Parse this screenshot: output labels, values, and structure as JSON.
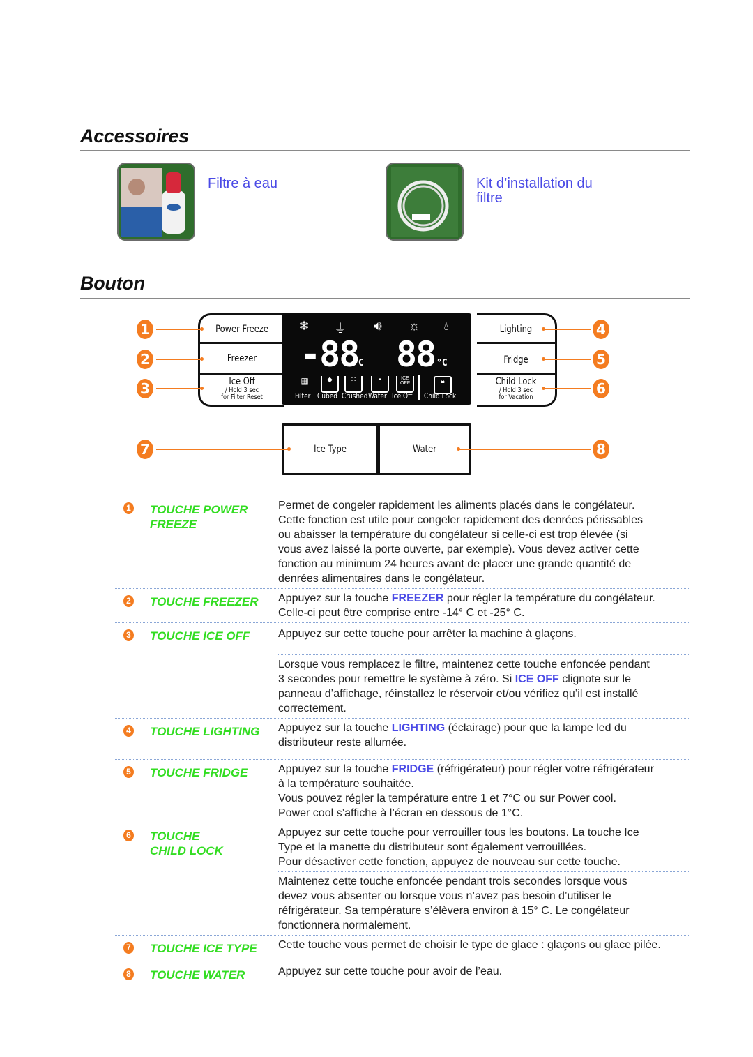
{
  "accessories": {
    "title": "Accessoires",
    "items": [
      {
        "label": "Filtre à eau",
        "image": "water-filter-photo"
      },
      {
        "label_line1": "Kit d’installation du",
        "label_line2": "filtre",
        "image": "filter-install-kit-photo"
      }
    ]
  },
  "buttons_section": {
    "title": "Bouton",
    "panel": {
      "left_buttons": [
        {
          "label": "Power Freeze",
          "callout": "1"
        },
        {
          "label": "Freezer",
          "callout": "2"
        },
        {
          "label": "Ice Off",
          "sub1": "/ Hold 3 sec",
          "sub2": "for Filter Reset",
          "callout": "3"
        }
      ],
      "right_buttons": [
        {
          "label": "Lighting",
          "callout": "4"
        },
        {
          "label": "Fridge",
          "callout": "5"
        },
        {
          "label": "Child Lock",
          "sub1": "/ Hold 3 sec",
          "sub2": "for Vacation",
          "callout": "6"
        }
      ],
      "display": {
        "top_icons": [
          "power-freeze-icon",
          "plug-icon",
          "speaker-icon",
          "light-bulb-icon",
          "water-drop-icon"
        ],
        "freezer_readout": "-88",
        "fridge_readout": "88",
        "unit": "°C",
        "bottom_labels": [
          "Filter",
          "Cubed",
          "Crushed",
          "Water",
          "Ice Off",
          "Child Lock"
        ]
      },
      "dispenser_buttons": [
        {
          "label": "Ice Type",
          "callout": "7"
        },
        {
          "label": "Water",
          "callout": "8"
        }
      ]
    }
  },
  "descriptions": [
    {
      "num": "1",
      "key_line1": "TOUCHE POWER",
      "key_line2": "FREEZE",
      "text": [
        "Permet de congeler rapidement les aliments placés dans le congélateur.",
        "Cette fonction est utile pour congeler rapidement des denrées périssables",
        "ou abaisser la température du congélateur si celle-ci est trop élevée (si",
        "vous avez laissé la porte ouverte, par exemple). Vous devez activer cette",
        "fonction au minimum 24 heures avant de placer une grande quantité de",
        "denrées alimentaires dans le congélateur."
      ]
    },
    {
      "num": "2",
      "key_line1": "TOUCHE FREEZER",
      "pre": "Appuyez sur la touche ",
      "highlight": "FREEZER",
      "post": " pour régler la température du congélateur.",
      "text2": "Celle-ci peut être comprise entre -14° C et -25° C."
    },
    {
      "num": "3",
      "key_line1": "TOUCHE ICE OFF",
      "text": "Appuyez sur cette touche pour arrêter la machine à glaçons.",
      "sub_line1": "Lorsque vous remplacez le filtre, maintenez cette touche enfoncée pendant",
      "sub_pre": "3 secondes pour remettre le système à zéro. Si ",
      "sub_highlight": "ICE OFF",
      "sub_post": " clignote sur le",
      "sub_line3": "panneau d’affichage, réinstallez le réservoir et/ou vérifiez qu’il est installé",
      "sub_line4": "correctement."
    },
    {
      "num": "4",
      "key_line1": "TOUCHE LIGHTING",
      "pre": "Appuyez sur la touche ",
      "highlight": "LIGHTING",
      "post": " (éclairage) pour que la lampe led du",
      "text2": "distributeur reste allumée."
    },
    {
      "num": "5",
      "key_line1": "TOUCHE FRIDGE",
      "pre": "Appuyez sur la touche ",
      "highlight": "FRIDGE",
      "post": " (réfrigérateur) pour régler votre réfrigérateur",
      "text2": "à la température souhaitée.",
      "text3": "Vous pouvez régler la température entre 1 et 7°C ou sur Power cool.",
      "text4": "Power cool s’affiche à l’écran en dessous de 1°C."
    },
    {
      "num": "6",
      "key_line1": "TOUCHE",
      "key_line2": "CHILD LOCK",
      "text": [
        "Appuyez sur cette touche pour verrouiller tous les boutons. La touche Ice",
        "Type et la manette du distributeur sont également verrouillées.",
        "Pour désactiver cette fonction, appuyez de nouveau sur cette touche."
      ],
      "sub": [
        "Maintenez cette touche enfoncée pendant trois secondes lorsque vous",
        "devez vous absenter ou lorsque vous n’avez pas besoin d’utiliser le",
        "réfrigérateur. Sa température s’élèvera environ à 15° C. Le congélateur",
        "fonctionnera normalement."
      ]
    },
    {
      "num": "7",
      "key_line1": "TOUCHE ICE TYPE",
      "text": "Cette touche vous permet de choisir le type de glace : glaçons ou glace pilée."
    },
    {
      "num": "8",
      "key_line1": "TOUCHE WATER",
      "text": "Appuyez sur cette touche pour avoir de l’eau."
    }
  ],
  "colors": {
    "accent_orange": "#f47c20",
    "key_green": "#33dd22",
    "highlight_blue": "#4a4ae6"
  }
}
